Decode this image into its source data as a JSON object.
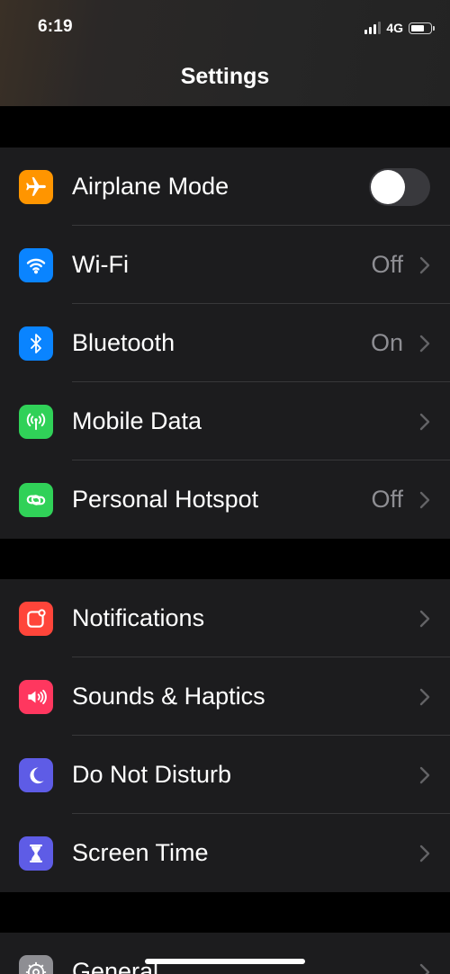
{
  "status_bar": {
    "time": "6:19",
    "network": "4G",
    "signal_bars": 3,
    "signal_bars_total": 4,
    "battery_level": 0.8
  },
  "header": {
    "title": "Settings"
  },
  "colors": {
    "orange": "#ff9500",
    "blue": "#0a84ff",
    "green": "#30d158",
    "red": "#ff453a",
    "pink": "#ff375f",
    "indigo": "#5e5ce6",
    "gray": "#8e8e93"
  },
  "groups": [
    {
      "items": [
        {
          "label": "Airplane Mode",
          "icon": "airplane-icon",
          "toggle": false
        },
        {
          "label": "Wi-Fi",
          "icon": "wifi-icon",
          "value": "Off"
        },
        {
          "label": "Bluetooth",
          "icon": "bluetooth-icon",
          "value": "On"
        },
        {
          "label": "Mobile Data",
          "icon": "antenna-icon",
          "value": ""
        },
        {
          "label": "Personal Hotspot",
          "icon": "hotspot-icon",
          "value": "Off"
        }
      ]
    },
    {
      "items": [
        {
          "label": "Notifications",
          "icon": "notifications-icon"
        },
        {
          "label": "Sounds & Haptics",
          "icon": "speaker-icon"
        },
        {
          "label": "Do Not Disturb",
          "icon": "moon-icon"
        },
        {
          "label": "Screen Time",
          "icon": "hourglass-icon"
        }
      ]
    },
    {
      "items": [
        {
          "label": "General",
          "icon": "gear-icon"
        }
      ]
    }
  ]
}
